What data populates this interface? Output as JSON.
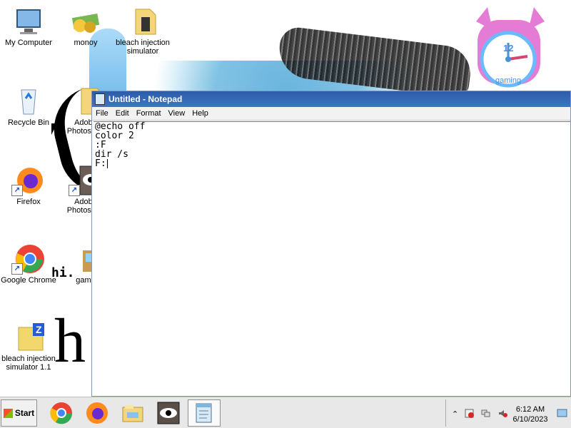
{
  "desktop": {
    "icons": [
      {
        "label": "My Computer",
        "icon": "computer-icon"
      },
      {
        "label": "monoy",
        "icon": "money-icon"
      },
      {
        "label": "bleach injection simulator",
        "icon": "folder-icon"
      },
      {
        "label": "Recycle Bin",
        "icon": "recycle-bin-icon"
      },
      {
        "label": "Adobe Photoshop",
        "icon": "folder-icon"
      },
      {
        "label": "Firefox",
        "icon": "firefox-icon"
      },
      {
        "label": "Adobe Photoshop",
        "icon": "photoshop-icon"
      },
      {
        "label": "Google Chrome",
        "icon": "chrome-icon"
      },
      {
        "label": "game",
        "icon": "game-icon"
      },
      {
        "label": "bleach injection simulator 1.1",
        "icon": "zip-folder-icon"
      }
    ],
    "decor": {
      "hi_text": "hi.",
      "big_h": "h",
      "clock_number": "12",
      "clock_text": "gaming"
    }
  },
  "notepad": {
    "title": "Untitled - Notepad",
    "menu": [
      "File",
      "Edit",
      "Format",
      "View",
      "Help"
    ],
    "content": [
      "@echo off",
      "color 2",
      ":F",
      "dir /s",
      "F:"
    ]
  },
  "taskbar": {
    "start_label": "Start",
    "apps": [
      {
        "name": "Google Chrome",
        "icon": "chrome-icon"
      },
      {
        "name": "Firefox",
        "icon": "firefox-icon"
      },
      {
        "name": "File Explorer",
        "icon": "explorer-icon"
      },
      {
        "name": "Photoshop",
        "icon": "eye-icon"
      },
      {
        "name": "Notepad",
        "icon": "notepad-icon"
      }
    ],
    "tray": {
      "time": "6:12 AM",
      "date": "6/10/2023"
    }
  },
  "colors": {
    "titlebar": "#2d5ca9",
    "window_border": "#8596b7",
    "taskbar": "#e8e8e8"
  }
}
